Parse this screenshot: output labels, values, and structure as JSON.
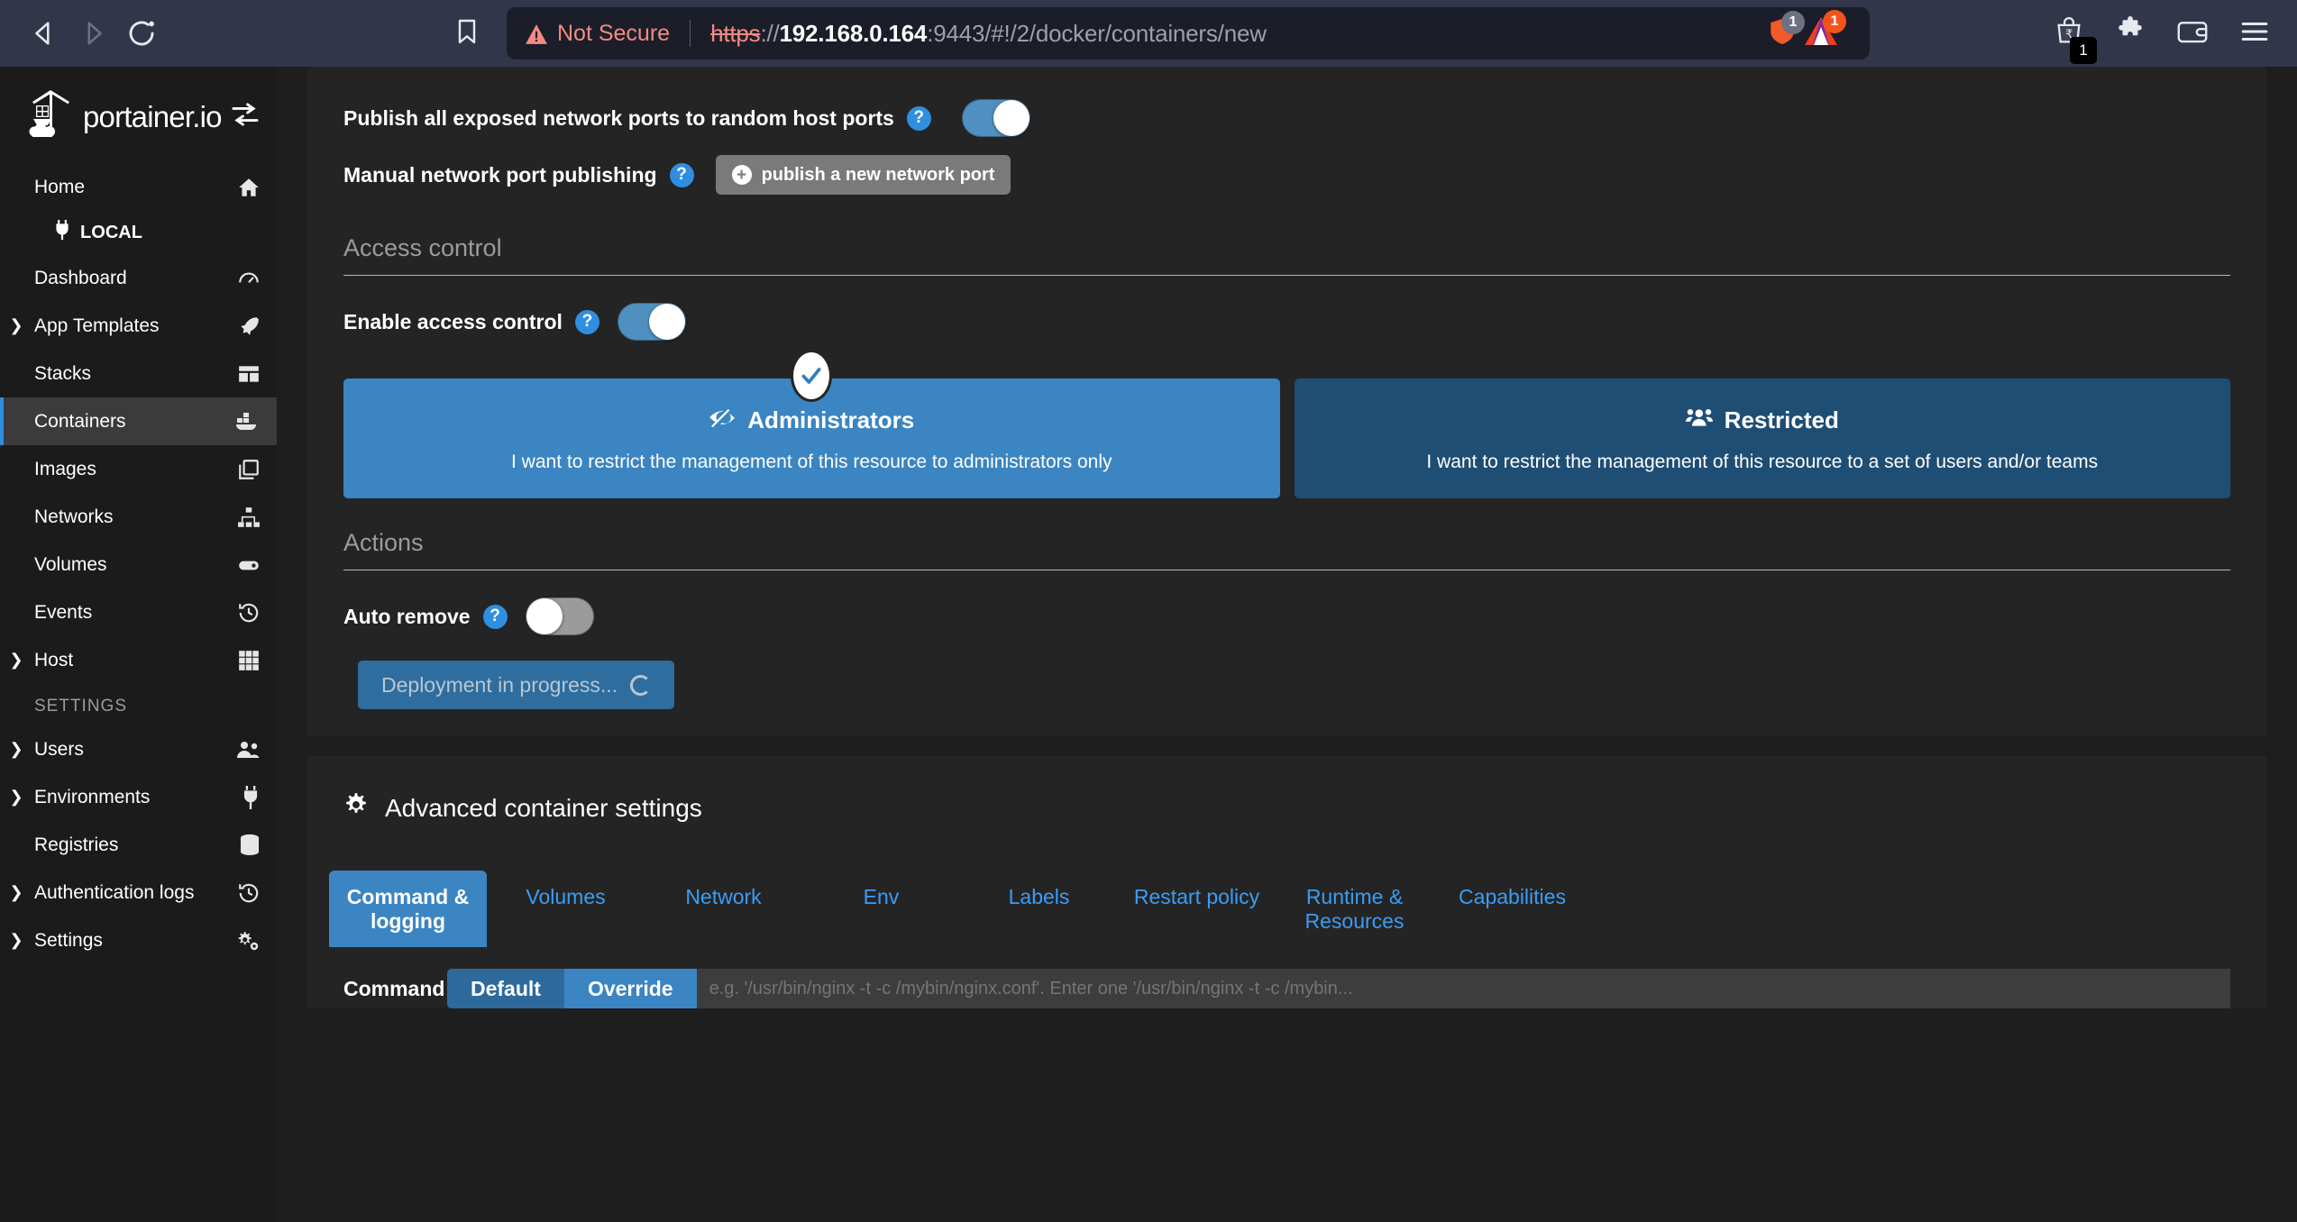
{
  "browser": {
    "back_icon": "back-arrow-icon",
    "forward_icon": "forward-arrow-icon",
    "reload_icon": "reload-icon",
    "bookmark_icon": "bookmark-icon",
    "security_label": "Not Secure",
    "url": {
      "scheme": "https",
      "separator": "://",
      "host": "192.168.0.164",
      "rest": ":9443/#!/2/docker/containers/new"
    },
    "shield_badge": "1",
    "brave_badge": "1",
    "wallet_badge": "1",
    "colors": {
      "not_secure": "#f28b82",
      "omnibox_bg": "#1b1d29",
      "chrome_bg": "#32364a"
    }
  },
  "sidebar": {
    "logo_text": "portainer.io",
    "local_label": "LOCAL",
    "section_label": "SETTINGS",
    "active_item": "Containers",
    "accent": "#2f8ee0",
    "items": [
      {
        "label": "Home",
        "icon": "home-icon",
        "expandable": false
      },
      {
        "label": "Dashboard",
        "icon": "gauge-icon",
        "expandable": false
      },
      {
        "label": "App Templates",
        "icon": "rocket-icon",
        "expandable": true
      },
      {
        "label": "Stacks",
        "icon": "stacks-icon",
        "expandable": false
      },
      {
        "label": "Containers",
        "icon": "containers-icon",
        "expandable": false
      },
      {
        "label": "Images",
        "icon": "images-icon",
        "expandable": false
      },
      {
        "label": "Networks",
        "icon": "networks-icon",
        "expandable": false
      },
      {
        "label": "Volumes",
        "icon": "volumes-icon",
        "expandable": false
      },
      {
        "label": "Events",
        "icon": "history-icon",
        "expandable": false
      },
      {
        "label": "Host",
        "icon": "grid-icon",
        "expandable": true
      }
    ],
    "settings_items": [
      {
        "label": "Users",
        "icon": "users-icon",
        "expandable": true
      },
      {
        "label": "Environments",
        "icon": "plug-icon",
        "expandable": true
      },
      {
        "label": "Registries",
        "icon": "database-icon",
        "expandable": false
      },
      {
        "label": "Authentication logs",
        "icon": "history-icon",
        "expandable": true
      },
      {
        "label": "Settings",
        "icon": "gears-icon",
        "expandable": true
      }
    ]
  },
  "main": {
    "publish_all_label": "Publish all exposed network ports to random host ports",
    "publish_all_state": "on",
    "manual_publish_label": "Manual network port publishing",
    "publish_port_button": "publish a new network port",
    "access_control": {
      "heading": "Access control",
      "enable_label": "Enable access control",
      "enable_state": "on",
      "cards": [
        {
          "title": "Administrators",
          "icon": "eye-slash-icon",
          "description": "I want to restrict the management of this resource to administrators only",
          "selected": true,
          "color": "#3b85c2"
        },
        {
          "title": "Restricted",
          "icon": "users-group-icon",
          "description": "I want to restrict the management of this resource to a set of users and/or teams",
          "selected": false,
          "color": "#1f4e75"
        }
      ]
    },
    "actions": {
      "heading": "Actions",
      "auto_remove_label": "Auto remove",
      "auto_remove_state": "off",
      "deploy_button": "Deployment in progress...",
      "deploy_spinner": "spinner-icon"
    },
    "advanced": {
      "title": "Advanced container settings",
      "title_icon": "gear-icon",
      "active_tab": "Command & logging",
      "tabs": [
        "Command & logging",
        "Volumes",
        "Network",
        "Env",
        "Labels",
        "Restart policy",
        "Runtime & Resources",
        "Capabilities"
      ],
      "command_row": {
        "label": "Command",
        "seg_default": "Default",
        "seg_override": "Override",
        "input_value": "e.g. '/usr/bin/nginx -t -c /mybin/nginx.conf'. Enter one '/usr/bin/nginx -t -c /mybin..."
      }
    }
  }
}
